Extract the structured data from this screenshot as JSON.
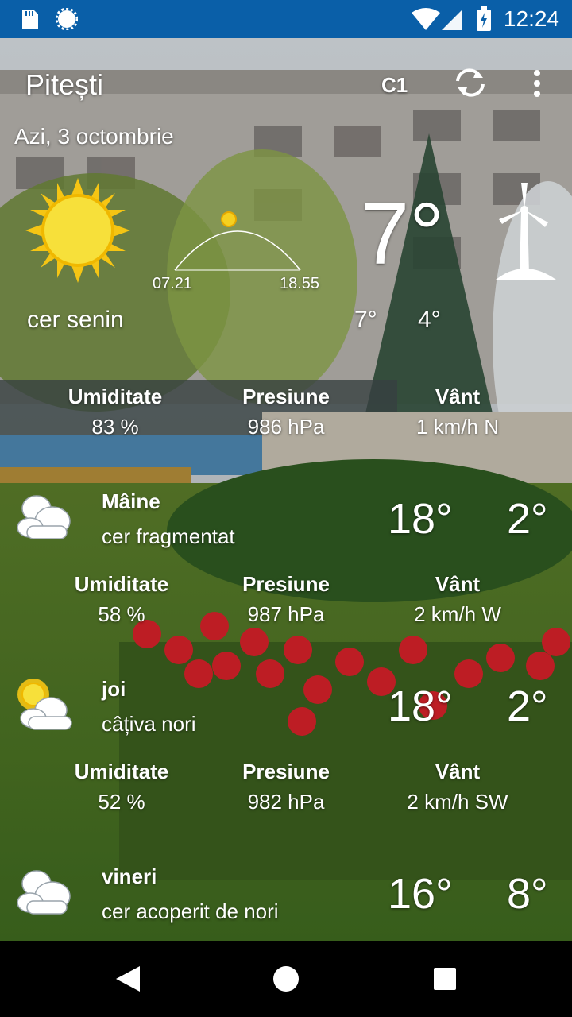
{
  "status_bar": {
    "time": "12:24"
  },
  "header": {
    "city": "Pitești",
    "unit_badge": "C1"
  },
  "today": {
    "date": "Azi, 3 octombrie",
    "temperature": "7°",
    "condition": "cer senin",
    "max": "7°",
    "min": "4°",
    "sunrise": "07.21",
    "sunset": "18.55",
    "humidity_label": "Umiditate",
    "humidity": "83 %",
    "pressure_label": "Presiune",
    "pressure": "986 hPa",
    "wind_label": "Vânt",
    "wind": "1 km/h N"
  },
  "forecast": [
    {
      "day": "Mâine",
      "condition": "cer fragmentat",
      "max": "18°",
      "min": "2°",
      "humidity_label": "Umiditate",
      "humidity": "58 %",
      "pressure_label": "Presiune",
      "pressure": "987 hPa",
      "wind_label": "Vânt",
      "wind": "2 km/h W",
      "icon": "cloud-icon"
    },
    {
      "day": "joi",
      "condition": "câțiva nori",
      "max": "18°",
      "min": "2°",
      "humidity_label": "Umiditate",
      "humidity": "52 %",
      "pressure_label": "Presiune",
      "pressure": "982 hPa",
      "wind_label": "Vânt",
      "wind": "2 km/h SW",
      "icon": "sun-cloud-icon"
    },
    {
      "day": "vineri",
      "condition": "cer acoperit de nori",
      "max": "16°",
      "min": "8°",
      "icon": "cloud-icon"
    }
  ]
}
